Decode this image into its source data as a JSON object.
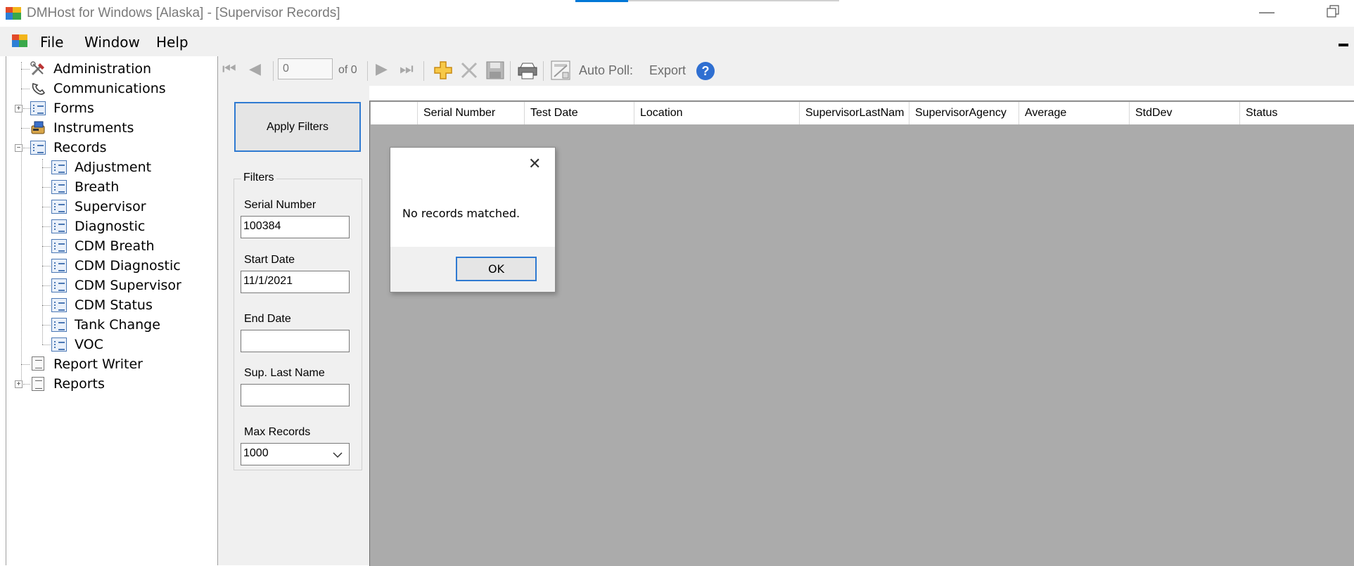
{
  "window": {
    "title": "DMHost for Windows [Alaska] - [Supervisor Records]",
    "minimize_glyph": "—"
  },
  "menubar": {
    "items": [
      "File",
      "Window",
      "Help"
    ]
  },
  "tree": {
    "items": [
      {
        "label": "Administration",
        "icon": "tools-icon"
      },
      {
        "label": "Communications",
        "icon": "phone-icon"
      },
      {
        "label": "Forms",
        "icon": "form-icon"
      },
      {
        "label": "Instruments",
        "icon": "instrument-icon"
      },
      {
        "label": "Records",
        "icon": "form-icon"
      },
      {
        "label": "Adjustment",
        "icon": "form-icon"
      },
      {
        "label": "Breath",
        "icon": "form-icon"
      },
      {
        "label": "Supervisor",
        "icon": "form-icon"
      },
      {
        "label": "Diagnostic",
        "icon": "form-icon"
      },
      {
        "label": "CDM Breath",
        "icon": "form-icon"
      },
      {
        "label": "CDM Diagnostic",
        "icon": "form-icon"
      },
      {
        "label": "CDM Supervisor",
        "icon": "form-icon"
      },
      {
        "label": "CDM Status",
        "icon": "form-icon"
      },
      {
        "label": "Tank Change",
        "icon": "form-icon"
      },
      {
        "label": "VOC",
        "icon": "form-icon"
      },
      {
        "label": "Report Writer",
        "icon": "report-icon"
      },
      {
        "label": "Reports",
        "icon": "report-icon"
      }
    ]
  },
  "toolbar": {
    "position_value": "0",
    "of_label": "of 0",
    "auto_poll_label": "Auto Poll:",
    "export_label": "Export",
    "help_glyph": "?"
  },
  "filters": {
    "apply_label": "Apply Filters",
    "group_label": "Filters",
    "serial_label": "Serial Number",
    "serial_value": "100384",
    "start_label": "Start Date",
    "start_value": "11/1/2021",
    "end_label": "End Date",
    "end_value": "",
    "lastname_label": "Sup. Last Name",
    "lastname_value": "",
    "max_label": "Max Records",
    "max_value": "1000"
  },
  "grid": {
    "columns": [
      "",
      "Serial Number",
      "Test Date",
      "Location",
      "SupervisorLastNam",
      "SupervisorAgency",
      "Average",
      "StdDev",
      "Status"
    ]
  },
  "dialog": {
    "message": "No records matched.",
    "ok_label": "OK",
    "close_glyph": "✕"
  },
  "colors": {
    "accent": "#0078d7",
    "grid_background": "#ababab",
    "panel": "#f0f0f0"
  }
}
